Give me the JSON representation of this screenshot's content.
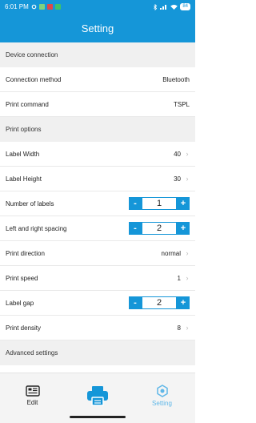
{
  "status": {
    "time": "6:01 PM",
    "battery": "84"
  },
  "app": {
    "title": "Setting"
  },
  "sections": {
    "device": "Device connection",
    "print_options": "Print options",
    "advanced": "Advanced settings"
  },
  "rows": {
    "connection_method": {
      "label": "Connection method",
      "value": "Bluetooth"
    },
    "print_command": {
      "label": "Print command",
      "value": "TSPL"
    },
    "label_width": {
      "label": "Label Width",
      "value": "40"
    },
    "label_height": {
      "label": "Label Height",
      "value": "30"
    },
    "number_of_labels": {
      "label": "Number of labels",
      "value": "1"
    },
    "lr_spacing": {
      "label": "Left and right spacing",
      "value": "2"
    },
    "print_direction": {
      "label": "Print direction",
      "value": "normal"
    },
    "print_speed": {
      "label": "Print speed",
      "value": "1"
    },
    "label_gap": {
      "label": "Label gap",
      "value": "2"
    },
    "print_density": {
      "label": "Print density",
      "value": "8"
    }
  },
  "stepper": {
    "minus": "-",
    "plus": "+"
  },
  "chevron": "›",
  "tabs": {
    "edit": "Edit",
    "setting": "Setting"
  },
  "colors": {
    "primary": "#1596d8",
    "tab_active": "#5fb7e8"
  },
  "icons": {
    "edit": "edit-document-icon",
    "print": "printer-icon",
    "setting": "settings-gear-icon"
  }
}
